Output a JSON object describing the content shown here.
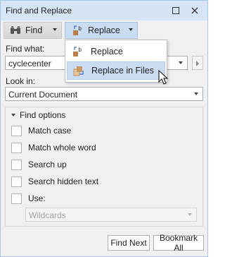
{
  "window": {
    "title": "Find and Replace"
  },
  "titlebar_buttons": {
    "maximize_icon": "maximize-icon",
    "close_icon": "close-icon"
  },
  "toolbar": {
    "find_label": "Find",
    "replace_label": "Replace"
  },
  "menu": {
    "items": [
      {
        "label": "Replace",
        "icon": "replace-icon"
      },
      {
        "label": "Replace in Files",
        "icon": "replace-in-files-icon"
      }
    ]
  },
  "find_what": {
    "label": "Find what:",
    "value": "cyclecenter"
  },
  "look_in": {
    "label": "Look in:",
    "value": "Current Document"
  },
  "find_options": {
    "title": "Find options",
    "checkboxes": [
      {
        "label": "Match case",
        "checked": false
      },
      {
        "label": "Match whole word",
        "checked": false
      },
      {
        "label": "Search up",
        "checked": false
      },
      {
        "label": "Search hidden text",
        "checked": false
      },
      {
        "label": "Use:",
        "checked": false
      }
    ],
    "use_value": "Wildcards"
  },
  "buttons": {
    "find_next": "Find Next",
    "bookmark_all": "Bookmark All"
  },
  "colors": {
    "titlebar": "#d6e4f5",
    "accent": "#c9dcf2",
    "icon_brown": "#b9804a",
    "icon_blue": "#3a6fc1"
  }
}
